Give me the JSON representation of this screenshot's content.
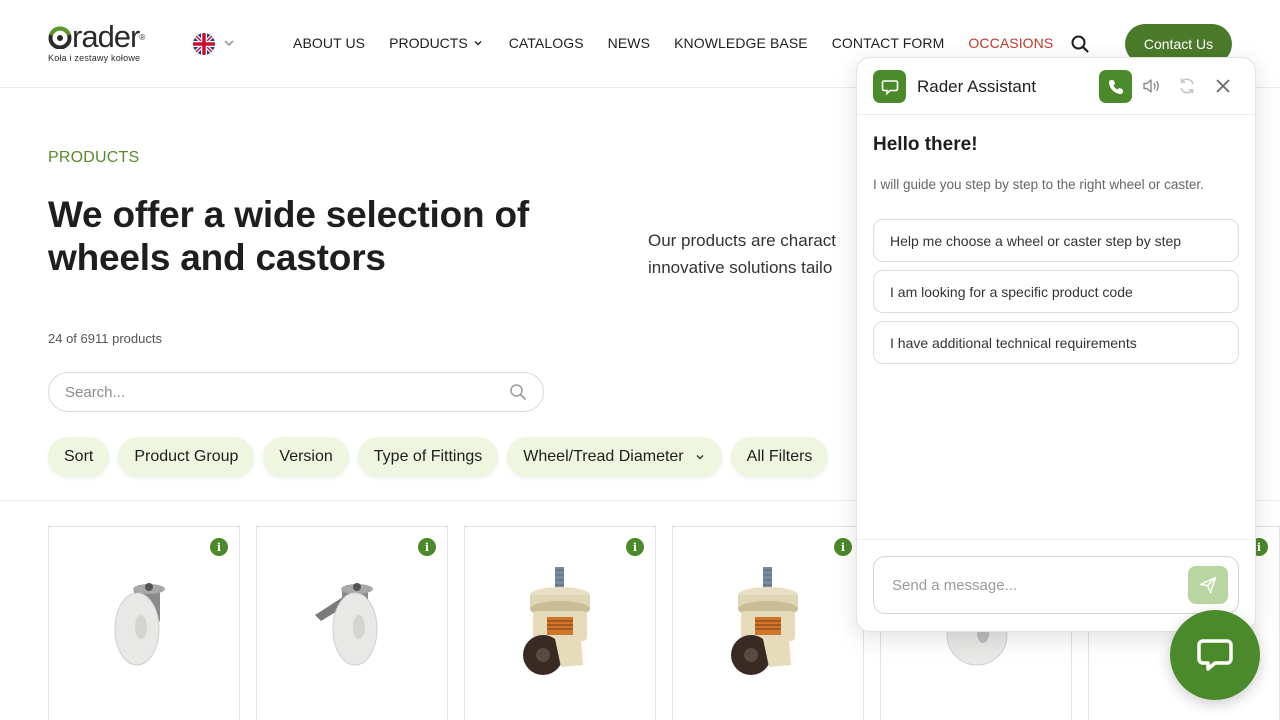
{
  "brand": {
    "logo_word": "rader",
    "logo_reg": "®",
    "logo_sub": "Koła i zestawy kołowe",
    "accent": "#4a7a2a",
    "accent_light": "#eef6df"
  },
  "header": {
    "language": "en-GB flag",
    "nav": [
      {
        "label": "ABOUT US"
      },
      {
        "label": "PRODUCTS"
      },
      {
        "label": "CATALOGS"
      },
      {
        "label": "NEWS"
      },
      {
        "label": "KNOWLEDGE BASE"
      },
      {
        "label": "CONTACT FORM"
      },
      {
        "label": "OCCASIONS"
      }
    ],
    "contact_label": "Contact Us"
  },
  "hero": {
    "breadcrumb": "PRODUCTS",
    "title": "We offer a wide selection of wheels and castors",
    "text_line1": "Our products are charact",
    "text_line2": "innovative solutions tailo"
  },
  "products": {
    "count_text": "24 of 6911 products",
    "search_placeholder": "Search...",
    "filters": [
      {
        "label": "Sort"
      },
      {
        "label": "Product Group"
      },
      {
        "label": "Version"
      },
      {
        "label": "Type of Fittings"
      },
      {
        "label": "Wheel/Tread Diameter"
      },
      {
        "label": "All Filters"
      }
    ],
    "info_glyph": "i"
  },
  "chat": {
    "title": "Rader Assistant",
    "greeting": "Hello there!",
    "subtitle": "I will guide you step by step to the right wheel or caster.",
    "options": [
      {
        "label": "Help me choose a wheel or caster step by step"
      },
      {
        "label": "I am looking for a specific product code"
      },
      {
        "label": "I have additional technical requirements"
      }
    ],
    "input_placeholder": "Send a message..."
  }
}
